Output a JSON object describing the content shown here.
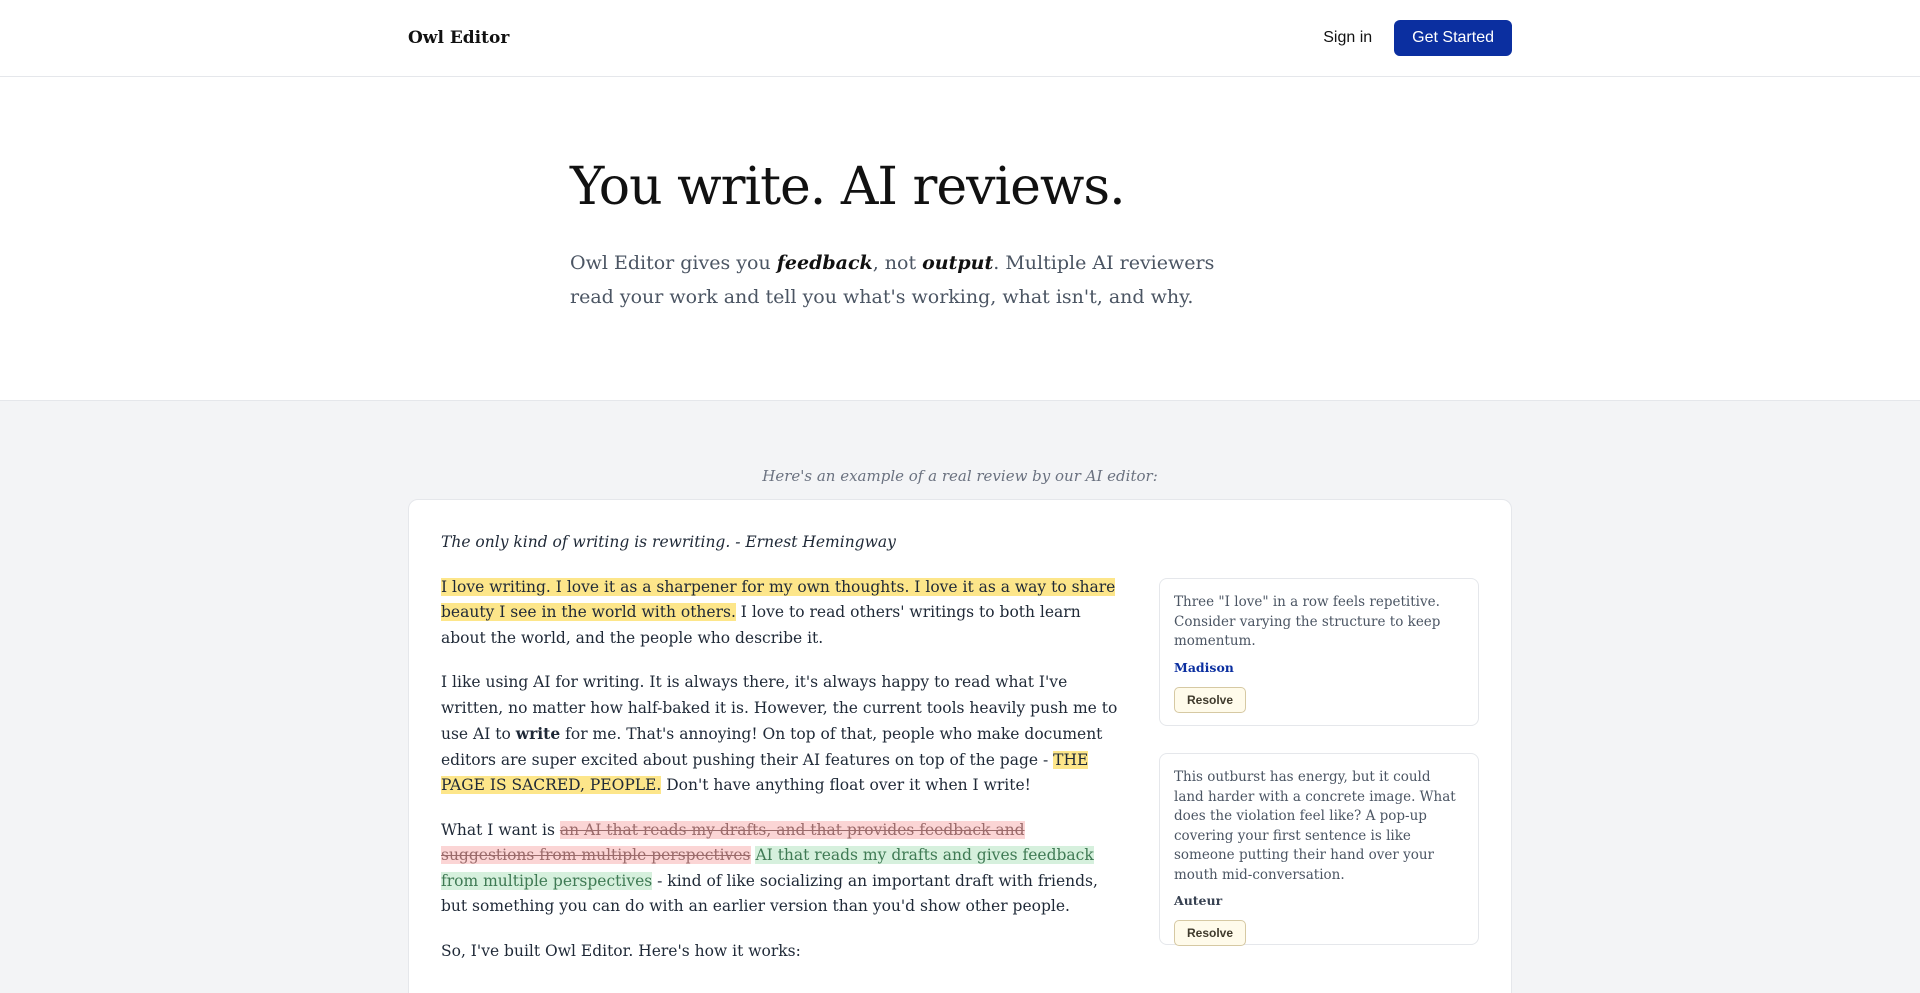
{
  "nav": {
    "brand": "Owl Editor",
    "signin": "Sign in",
    "cta": "Get Started"
  },
  "hero": {
    "title": "You write. AI reviews.",
    "lead_1": "Owl Editor gives you ",
    "em_1": "feedback",
    "lead_2": ", not ",
    "em_2": "output",
    "lead_3": ". Multiple AI reviewers read your work and tell you what's working, what isn't, and why."
  },
  "example": {
    "caption": "Here's an example of a real review by our AI editor:",
    "quote": "The only kind of writing is rewriting. - Ernest Hemingway",
    "p1_hl": "I love writing. I love it as a sharpener for my own thoughts. I love it as a way to share beauty I see in the world with others.",
    "p1_rest": " I love to read others' writings to both learn about the world, and the people who describe it.",
    "p2_a": "I like using AI for writing. It is always there, it's always happy to read what I've written, no matter how half-baked it is. However, the current tools heavily push me to use AI to ",
    "p2_bold": "write",
    "p2_b": " for me. That's annoying! On top of that, people who make document editors are super excited about pushing their AI features on top of the page - ",
    "p2_hl": "THE PAGE IS SACRED, PEOPLE.",
    "p2_c": " Don't have anything float over it when I write!",
    "p3_a": "What I want is ",
    "p3_del": "an AI that reads my drafts, and that provides feedback and suggestions from multiple perspectives",
    "p3_ins": "AI that reads my drafts and gives feedback from multiple perspectives",
    "p3_b": " - kind of like socializing an important draft with friends, but something you can do with an earlier version than you'd show other people.",
    "p4": "So, I've built Owl Editor. Here's how it works:"
  },
  "comments": [
    {
      "text": "Three \"I love\" in a row feels repetitive. Consider varying the structure to keep momentum.",
      "author": "Madison",
      "action": "Resolve"
    },
    {
      "text": "This outburst has energy, but it could land harder with a concrete image. What does the violation feel like? A pop-up covering your first sentence is like someone putting their hand over your mouth mid-conversation.",
      "author": "Auteur",
      "action": "Resolve"
    }
  ],
  "colors": {
    "accent": "#0b2fa0",
    "highlight": "#fde68a",
    "deletion": "#fbd5d5",
    "insertion": "#d6f0dd"
  }
}
